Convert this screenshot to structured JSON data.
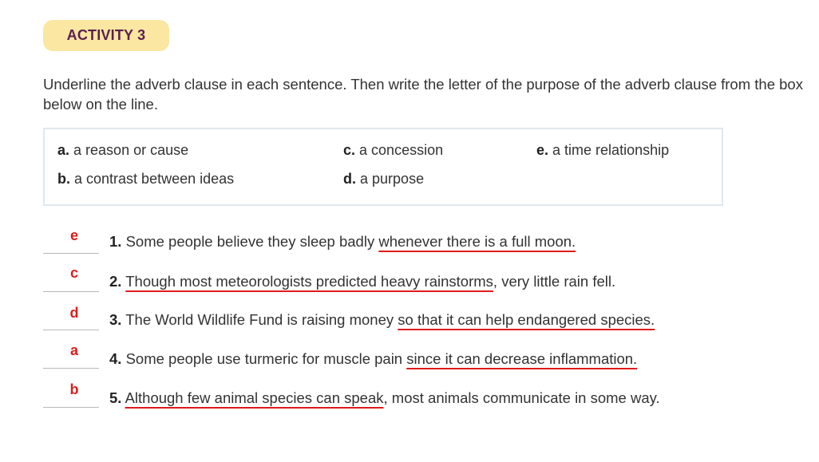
{
  "badge": {
    "label": "ACTIVITY 3"
  },
  "instructions": "Underline the adverb clause in each sentence. Then write the letter of the purpose of the adverb clause from the box below on the line.",
  "options": [
    {
      "letter": "a.",
      "text": "a reason or cause"
    },
    {
      "letter": "b.",
      "text": "a contrast between ideas"
    },
    {
      "letter": "c.",
      "text": "a concession"
    },
    {
      "letter": "d.",
      "text": "a purpose"
    },
    {
      "letter": "e.",
      "text": "a time relationship"
    }
  ],
  "items": [
    {
      "answer": "e",
      "number": "1.",
      "before": "Some people believe they sleep badly ",
      "clause": "whenever there is a full moon.",
      "after": ""
    },
    {
      "answer": "c",
      "number": "2.",
      "before": "",
      "clause": "Though most meteorologists predicted heavy rainstorms",
      "after": ", very little rain fell."
    },
    {
      "answer": "d",
      "number": "3.",
      "before": "The World Wildlife Fund is raising money ",
      "clause": "so that it can help endangered species.",
      "after": ""
    },
    {
      "answer": "a",
      "number": "4.",
      "before": "Some people use turmeric for muscle pain ",
      "clause": "since it can decrease inflammation.",
      "after": ""
    },
    {
      "answer": "b",
      "number": "5.",
      "before": "",
      "clause": "Although few animal species can speak",
      "after": ", most animals communicate in some way."
    }
  ],
  "colors": {
    "badge_bg": "#fbe7a1",
    "badge_text": "#5b1f4f",
    "answer": "#e01b1b",
    "underline": "#e01b1b",
    "box_border": "#dfe8ef"
  }
}
